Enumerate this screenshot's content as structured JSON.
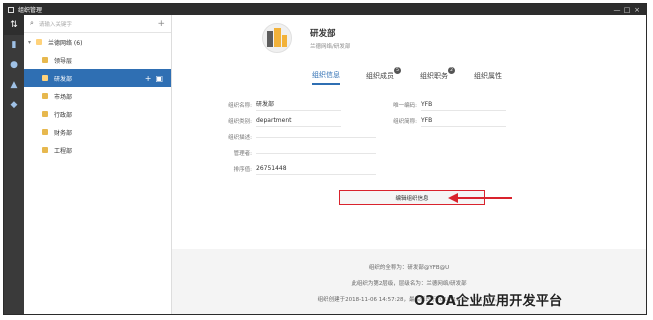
{
  "window": {
    "title": "组织管理",
    "controls": [
      "—",
      "□",
      "×"
    ]
  },
  "search": {
    "placeholder": "请输入关键字",
    "add": "+"
  },
  "tree": {
    "root": {
      "label": "兰德网络 (6)"
    },
    "items": [
      {
        "label": "领导层",
        "selected": false
      },
      {
        "label": "研发部",
        "selected": true
      },
      {
        "label": "市场部",
        "selected": false
      },
      {
        "label": "行政部",
        "selected": false
      },
      {
        "label": "财务部",
        "selected": false
      },
      {
        "label": "工程部",
        "selected": false
      }
    ],
    "actions": {
      "add": "+",
      "delete": "🗑"
    }
  },
  "org": {
    "name": "研发部",
    "path": "兰德网络/研发部"
  },
  "tabs": [
    {
      "label": "组织信息",
      "active": true,
      "badge": ""
    },
    {
      "label": "组织成员",
      "active": false,
      "badge": "5"
    },
    {
      "label": "组织职务",
      "active": false,
      "badge": "2"
    },
    {
      "label": "组织属性",
      "active": false,
      "badge": ""
    }
  ],
  "form": {
    "name": {
      "label": "组织名称:",
      "value": "研发部"
    },
    "unique_code": {
      "label": "唯一编码:",
      "value": "YFB"
    },
    "category": {
      "label": "组织类别:",
      "value": "department"
    },
    "short_name": {
      "label": "组织简称:",
      "value": "YFB"
    },
    "description": {
      "label": "组织描述:",
      "value": ""
    },
    "manager": {
      "label": "管理者:",
      "value": ""
    },
    "order": {
      "label": "排序值:",
      "value": "26751448"
    }
  },
  "edit_button": "编辑组织信息",
  "footer": {
    "full_name": "组织的全称为：研发部@YFB@U",
    "level": "此组织为第2层级，层级名为：兰德网络/研发部",
    "created": "组织创建于2018-11-06 14:57:28，最后修改于2018-11-06 14:57:28。"
  },
  "watermark": "O2OA企业应用开发平台",
  "colors": {
    "accent": "#2f6fb3",
    "highlight": "#d9232d",
    "titlebar": "#2d2d2d"
  }
}
